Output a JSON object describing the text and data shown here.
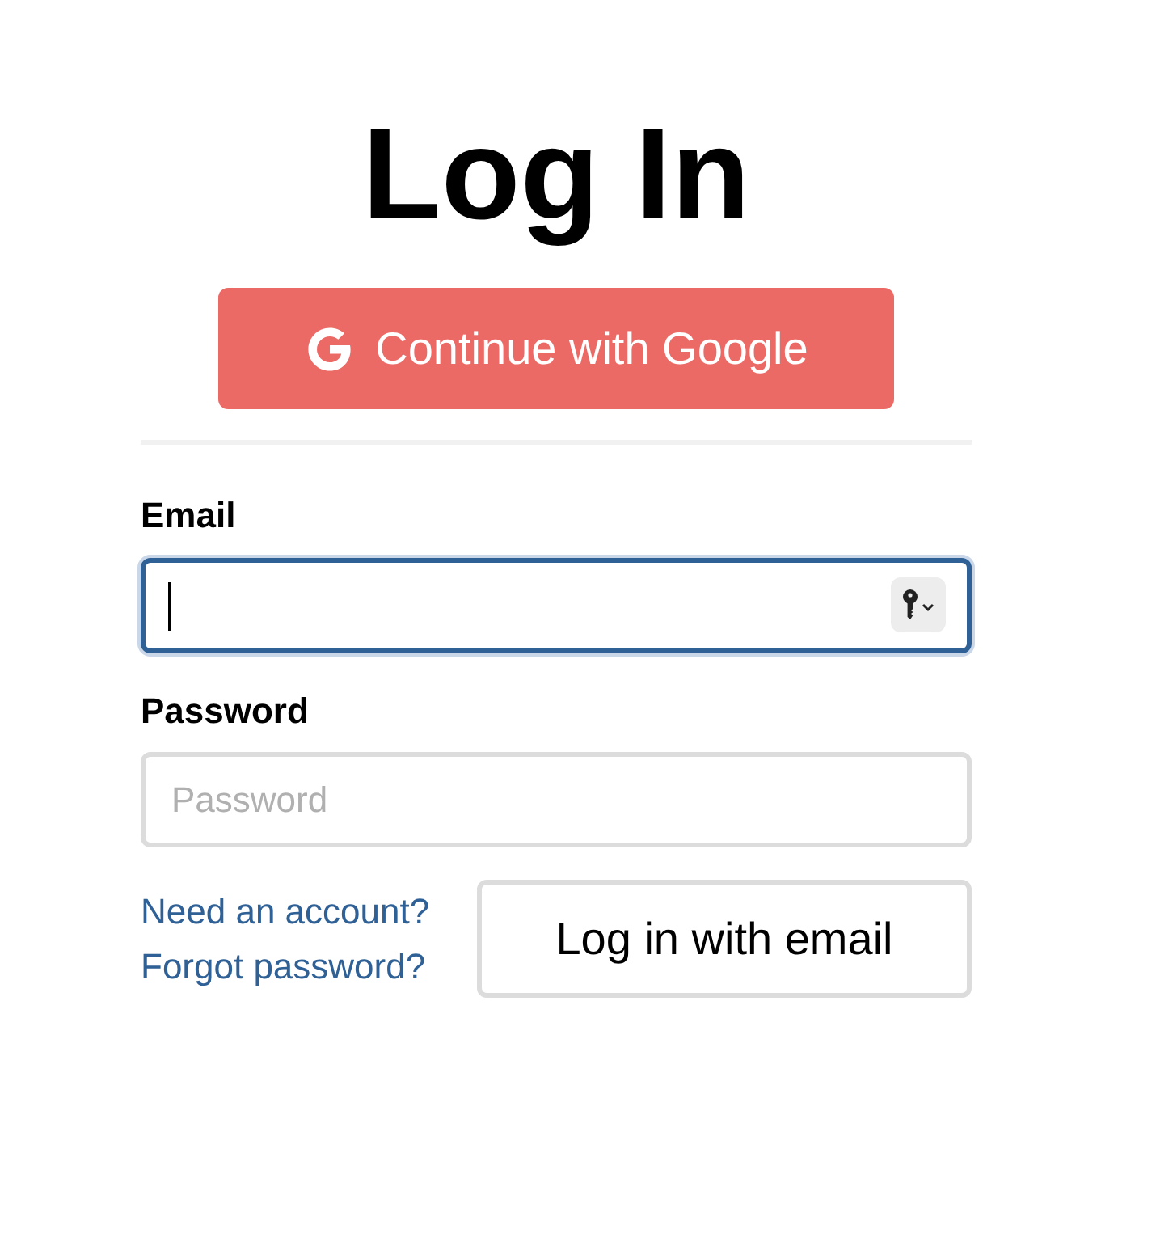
{
  "title": "Log In",
  "google_button": {
    "label": "Continue with Google"
  },
  "fields": [
    {
      "label": "Email",
      "kind": "email",
      "focused": true
    },
    {
      "label": "Password",
      "kind": "password",
      "placeholder": "Password",
      "focused": false
    }
  ],
  "links": [
    "Need an account?",
    "Forgot password?"
  ],
  "submit_button": {
    "label": "Log in with email"
  }
}
